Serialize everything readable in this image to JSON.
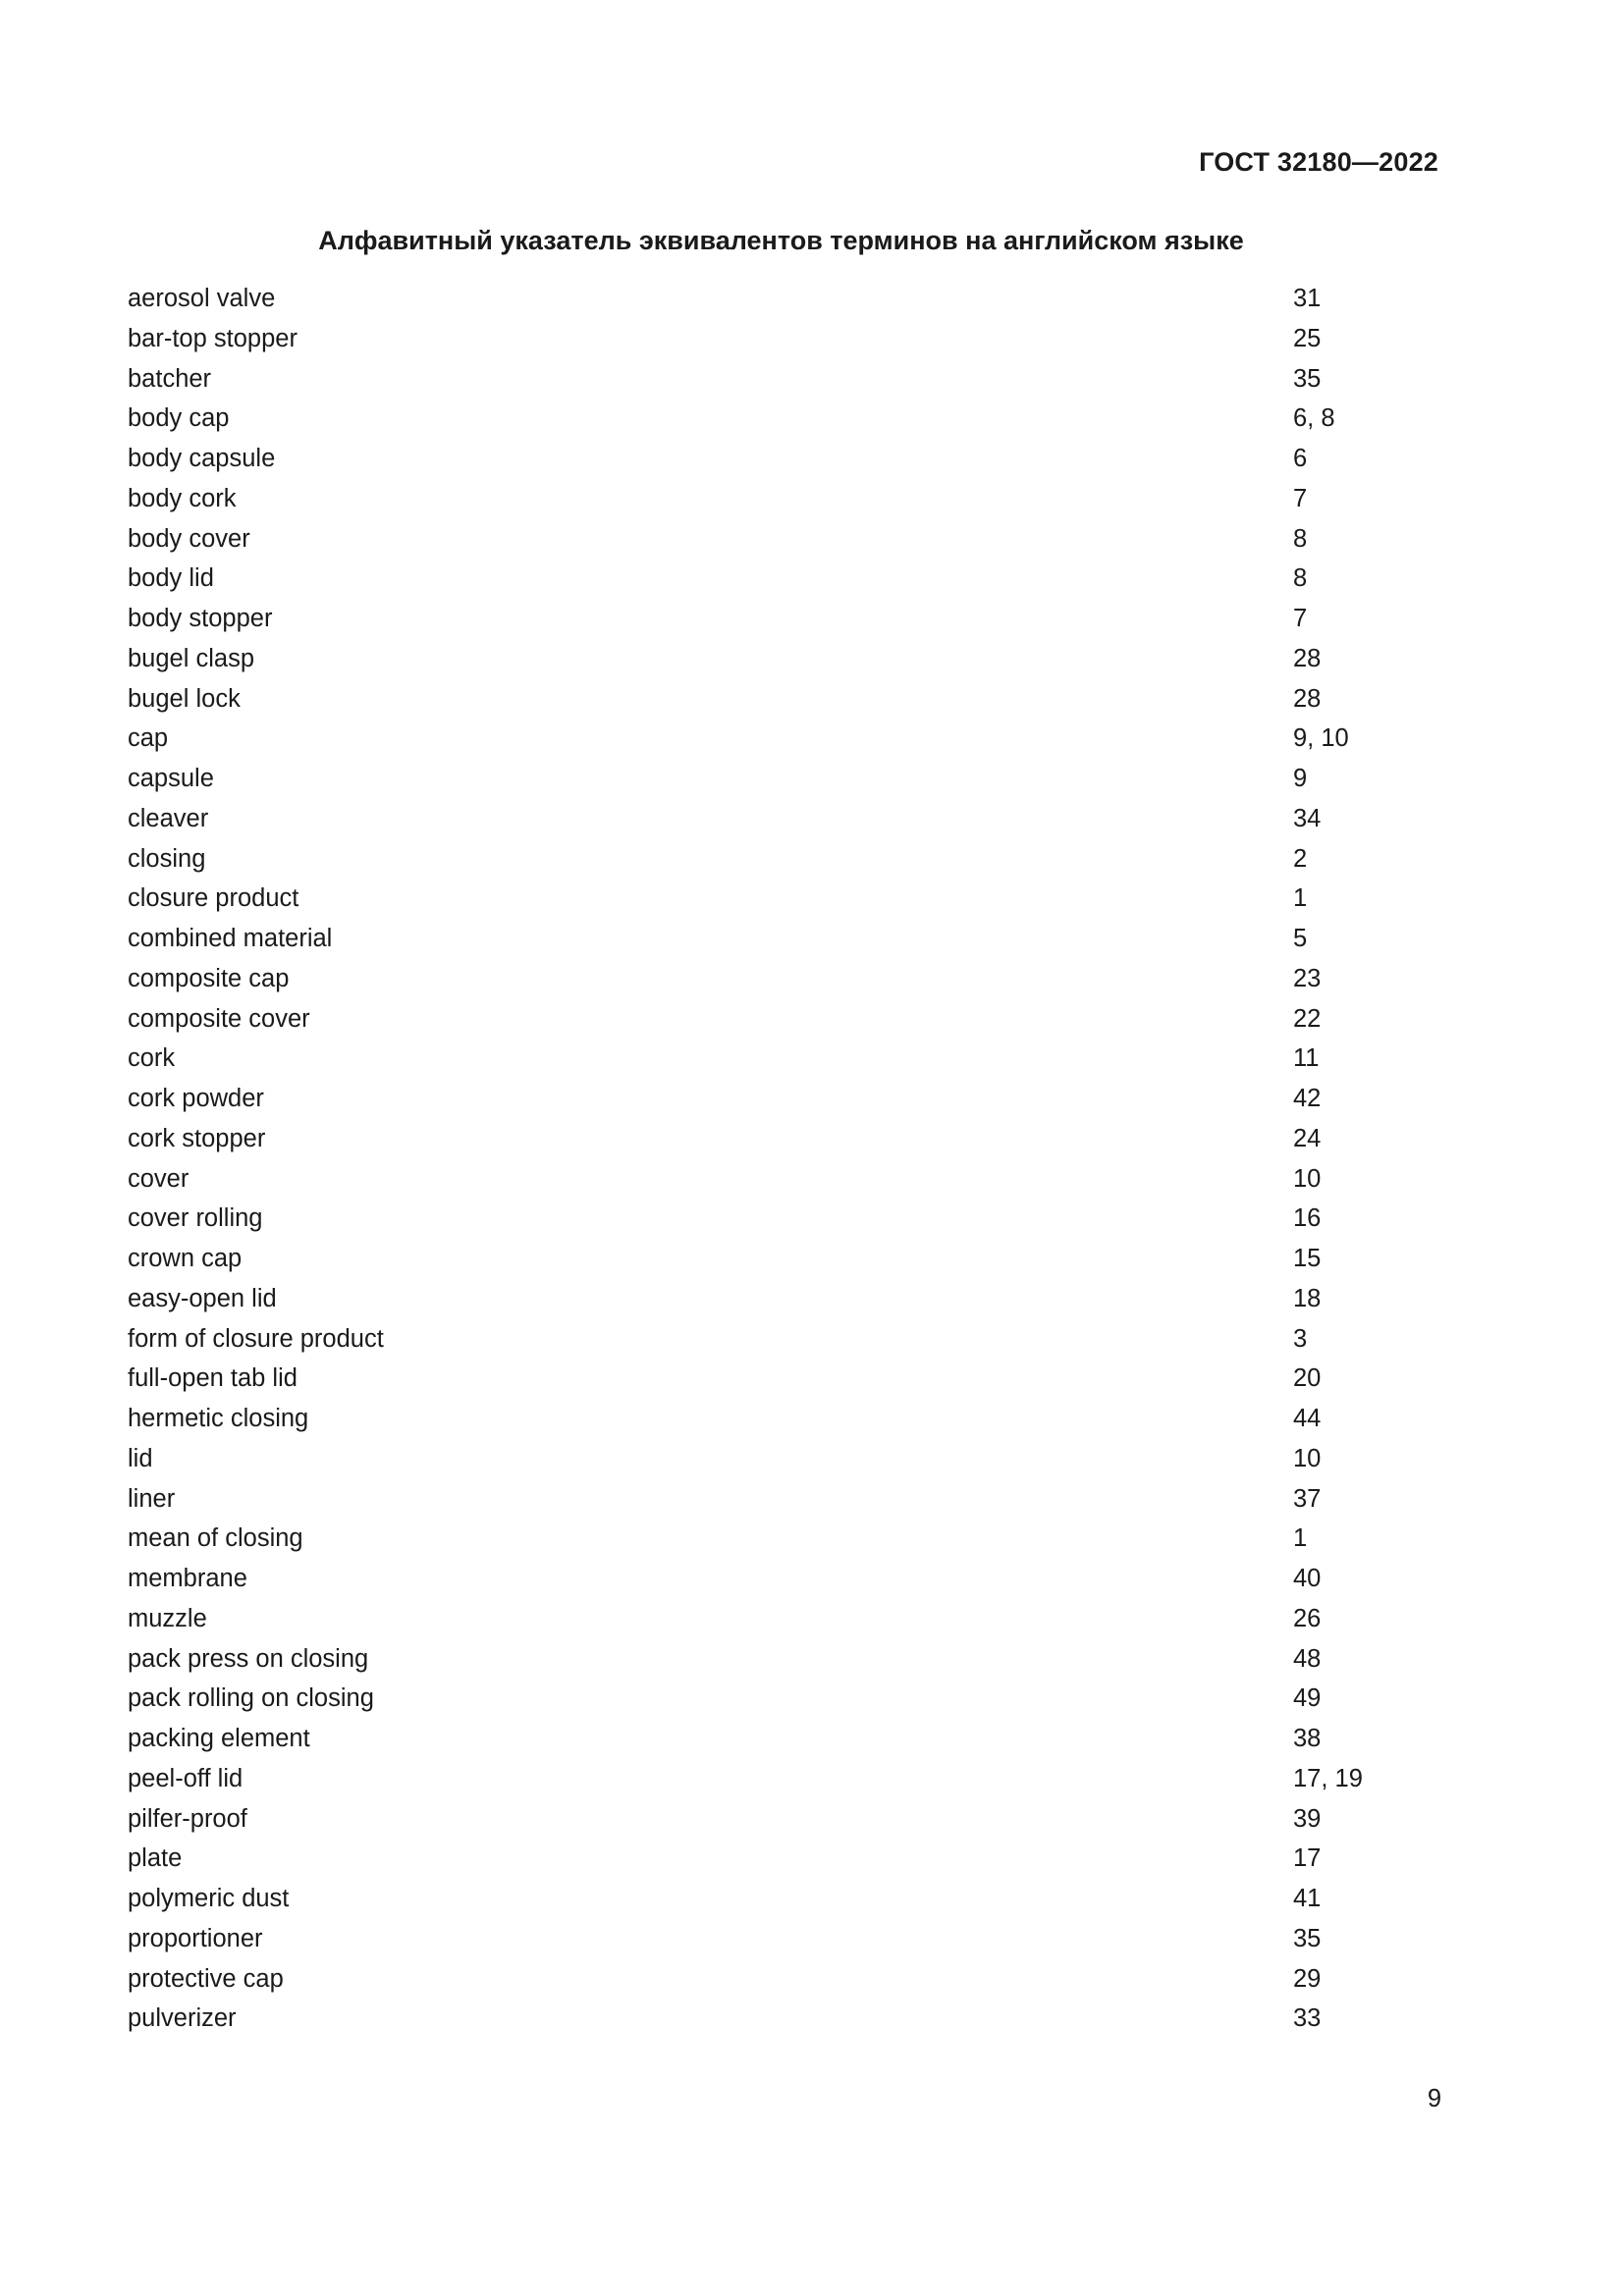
{
  "header": {
    "doc_code": "ГОСТ 32180—2022"
  },
  "title": "Алфавитный указатель эквивалентов терминов на английском языке",
  "entries": [
    {
      "term": "aerosol valve",
      "ref": "31"
    },
    {
      "term": "bar-top stopper",
      "ref": "25"
    },
    {
      "term": "batcher",
      "ref": "35"
    },
    {
      "term": "body cap",
      "ref": "6, 8"
    },
    {
      "term": "body capsule",
      "ref": "6"
    },
    {
      "term": "body cork",
      "ref": "7"
    },
    {
      "term": "body cover",
      "ref": "8"
    },
    {
      "term": "body lid",
      "ref": "8"
    },
    {
      "term": "body stopper",
      "ref": "7"
    },
    {
      "term": "bugel clasp",
      "ref": "28"
    },
    {
      "term": "bugel lock",
      "ref": "28"
    },
    {
      "term": "cap",
      "ref": "9, 10"
    },
    {
      "term": "capsule",
      "ref": "9"
    },
    {
      "term": "cleaver",
      "ref": "34"
    },
    {
      "term": "closing",
      "ref": "2"
    },
    {
      "term": "closure product",
      "ref": "1"
    },
    {
      "term": "combined material",
      "ref": "5"
    },
    {
      "term": "composite cap",
      "ref": "23"
    },
    {
      "term": "composite cover",
      "ref": "22"
    },
    {
      "term": "cork",
      "ref": "11"
    },
    {
      "term": "cork powder",
      "ref": "42"
    },
    {
      "term": "cork stopper",
      "ref": "24"
    },
    {
      "term": "cover",
      "ref": "10"
    },
    {
      "term": "cover rolling",
      "ref": "16"
    },
    {
      "term": "crown cap",
      "ref": "15"
    },
    {
      "term": "easy-open lid",
      "ref": "18"
    },
    {
      "term": "form of closure product",
      "ref": "3"
    },
    {
      "term": "full-open tab lid",
      "ref": "20"
    },
    {
      "term": "hermetic closing",
      "ref": "44"
    },
    {
      "term": "lid",
      "ref": "10"
    },
    {
      "term": "liner",
      "ref": "37"
    },
    {
      "term": "mean of closing",
      "ref": "1"
    },
    {
      "term": "membrane",
      "ref": "40"
    },
    {
      "term": "muzzle",
      "ref": "26"
    },
    {
      "term": "pack press on closing",
      "ref": "48"
    },
    {
      "term": "pack rolling on closing",
      "ref": "49"
    },
    {
      "term": "packing element",
      "ref": "38"
    },
    {
      "term": "peel-off lid",
      "ref": "17, 19"
    },
    {
      "term": "pilfer-proof",
      "ref": "39"
    },
    {
      "term": "plate",
      "ref": "17"
    },
    {
      "term": "polymeric dust",
      "ref": "41"
    },
    {
      "term": "proportioner",
      "ref": "35"
    },
    {
      "term": "protective cap",
      "ref": "29"
    },
    {
      "term": "pulverizer",
      "ref": "33"
    }
  ],
  "footer": {
    "page_number": "9"
  }
}
